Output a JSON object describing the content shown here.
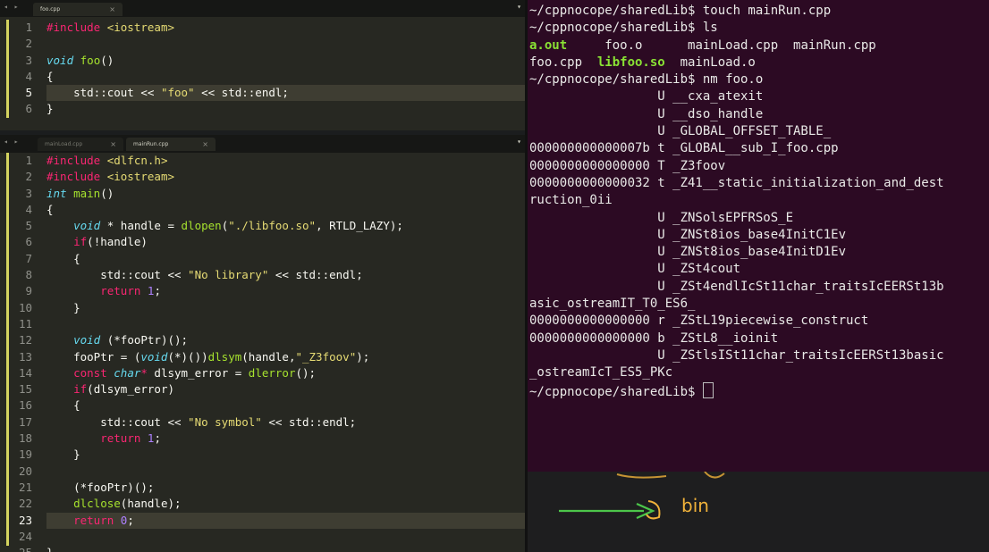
{
  "editor_top": {
    "tab": "foo.cpp",
    "nav": "◂ ▸",
    "close": "×",
    "menu_arrow": "▾",
    "lines": [
      [
        [
          "pp",
          "#include "
        ],
        [
          "s",
          "<iostream>"
        ]
      ],
      [],
      [
        [
          "t",
          "void "
        ],
        [
          "f",
          "foo"
        ],
        [
          "p",
          "()"
        ]
      ],
      [
        [
          "p",
          "{"
        ]
      ],
      [
        [
          "p",
          "    std::cout << "
        ],
        [
          "s",
          "\"foo\""
        ],
        [
          "p",
          " << std::endl;"
        ]
      ],
      [
        [
          "p",
          "}"
        ]
      ]
    ],
    "highlight_line": 5
  },
  "editor_bottom": {
    "tabs": [
      "mainLoad.cpp",
      "mainRun.cpp"
    ],
    "nav": "◂ ▸",
    "close": "×",
    "menu_arrow": "▾",
    "lines": [
      [
        [
          "pp",
          "#include "
        ],
        [
          "s",
          "<dlfcn.h>"
        ]
      ],
      [
        [
          "pp",
          "#include "
        ],
        [
          "s",
          "<iostream>"
        ]
      ],
      [
        [
          "t",
          "int "
        ],
        [
          "f",
          "main"
        ],
        [
          "p",
          "()"
        ]
      ],
      [
        [
          "p",
          "{"
        ]
      ],
      [
        [
          "p",
          "    "
        ],
        [
          "t",
          "void"
        ],
        [
          "p",
          " * handle = "
        ],
        [
          "f",
          "dlopen"
        ],
        [
          "p",
          "("
        ],
        [
          "s",
          "\"./libfoo.so\""
        ],
        [
          "p",
          ", RTLD_LAZY);"
        ]
      ],
      [
        [
          "p",
          "    "
        ],
        [
          "k",
          "if"
        ],
        [
          "p",
          "(!handle)"
        ]
      ],
      [
        [
          "p",
          "    {"
        ]
      ],
      [
        [
          "p",
          "        std::cout << "
        ],
        [
          "s",
          "\"No library\""
        ],
        [
          "p",
          " << std::endl;"
        ]
      ],
      [
        [
          "p",
          "        "
        ],
        [
          "k",
          "return "
        ],
        [
          "n",
          "1"
        ],
        [
          "p",
          ";"
        ]
      ],
      [
        [
          "p",
          "    }"
        ]
      ],
      [],
      [
        [
          "p",
          "    "
        ],
        [
          "t",
          "void"
        ],
        [
          "p",
          " (*fooPtr)();"
        ]
      ],
      [
        [
          "p",
          "    fooPtr = ("
        ],
        [
          "t",
          "void"
        ],
        [
          "p",
          "(*)())"
        ],
        [
          "f",
          "dlsym"
        ],
        [
          "p",
          "(handle,"
        ],
        [
          "s",
          "\"_Z3foov\""
        ],
        [
          "p",
          ");"
        ]
      ],
      [
        [
          "p",
          "    "
        ],
        [
          "k",
          "const "
        ],
        [
          "t",
          "char"
        ],
        [
          "k",
          "*"
        ],
        [
          "p",
          " dlsym_error = "
        ],
        [
          "f",
          "dlerror"
        ],
        [
          "p",
          "();"
        ]
      ],
      [
        [
          "p",
          "    "
        ],
        [
          "k",
          "if"
        ],
        [
          "p",
          "(dlsym_error)"
        ]
      ],
      [
        [
          "p",
          "    {"
        ]
      ],
      [
        [
          "p",
          "        std::cout << "
        ],
        [
          "s",
          "\"No symbol\""
        ],
        [
          "p",
          " << std::endl;"
        ]
      ],
      [
        [
          "p",
          "        "
        ],
        [
          "k",
          "return "
        ],
        [
          "n",
          "1"
        ],
        [
          "p",
          ";"
        ]
      ],
      [
        [
          "p",
          "    }"
        ]
      ],
      [],
      [
        [
          "p",
          "    (*fooPtr)();"
        ]
      ],
      [
        [
          "p",
          "    "
        ],
        [
          "f",
          "dlclose"
        ],
        [
          "p",
          "(handle);"
        ]
      ],
      [
        [
          "p",
          "    "
        ],
        [
          "k",
          "return "
        ],
        [
          "n",
          "0"
        ],
        [
          "p",
          ";"
        ]
      ],
      [],
      [
        [
          "p",
          "}"
        ]
      ]
    ],
    "highlight_line": 23
  },
  "terminal": {
    "lines": [
      [
        [
          "p",
          "~/cppnocope/sharedLib$ touch mainRun.cpp"
        ]
      ],
      [
        [
          "p",
          "~/cppnocope/sharedLib$ ls"
        ]
      ],
      [
        [
          "g",
          "a.out"
        ],
        [
          "p",
          "     foo.o      mainLoad.cpp  mainRun.cpp"
        ]
      ],
      [
        [
          "p",
          "foo.cpp  "
        ],
        [
          "g",
          "libfoo.so"
        ],
        [
          "p",
          "  mainLoad.o"
        ]
      ],
      [
        [
          "p",
          "~/cppnocope/sharedLib$ nm foo.o"
        ]
      ],
      [
        [
          "p",
          "                 U __cxa_atexit"
        ]
      ],
      [
        [
          "p",
          "                 U __dso_handle"
        ]
      ],
      [
        [
          "p",
          "                 U _GLOBAL_OFFSET_TABLE_"
        ]
      ],
      [
        [
          "p",
          "000000000000007b t _GLOBAL__sub_I_foo.cpp"
        ]
      ],
      [
        [
          "p",
          "0000000000000000 T _Z3foov"
        ]
      ],
      [
        [
          "p",
          "0000000000000032 t _Z41__static_initialization_and_dest"
        ]
      ],
      [
        [
          "p",
          "ruction_0ii"
        ]
      ],
      [
        [
          "p",
          "                 U _ZNSolsEPFRSoS_E"
        ]
      ],
      [
        [
          "p",
          "                 U _ZNSt8ios_base4InitC1Ev"
        ]
      ],
      [
        [
          "p",
          "                 U _ZNSt8ios_base4InitD1Ev"
        ]
      ],
      [
        [
          "p",
          "                 U _ZSt4cout"
        ]
      ],
      [
        [
          "p",
          "                 U _ZSt4endlIcSt11char_traitsIcEERSt13b"
        ]
      ],
      [
        [
          "p",
          "asic_ostreamIT_T0_ES6_"
        ]
      ],
      [
        [
          "p",
          "0000000000000000 r _ZStL19piecewise_construct"
        ]
      ],
      [
        [
          "p",
          "0000000000000000 b _ZStL8__ioinit"
        ]
      ],
      [
        [
          "p",
          "                 U _ZStlsISt11char_traitsIcEERSt13basic"
        ]
      ],
      [
        [
          "p",
          "_ostreamIcT_ES5_PKc"
        ]
      ],
      [
        [
          "p",
          "~/cppnocope/sharedLib$ "
        ],
        [
          "c",
          ""
        ]
      ]
    ]
  },
  "whiteboard": {
    "text": "bin",
    "colors": {
      "ink": "#f0b23a",
      "arrow": "#4cc64a"
    }
  }
}
